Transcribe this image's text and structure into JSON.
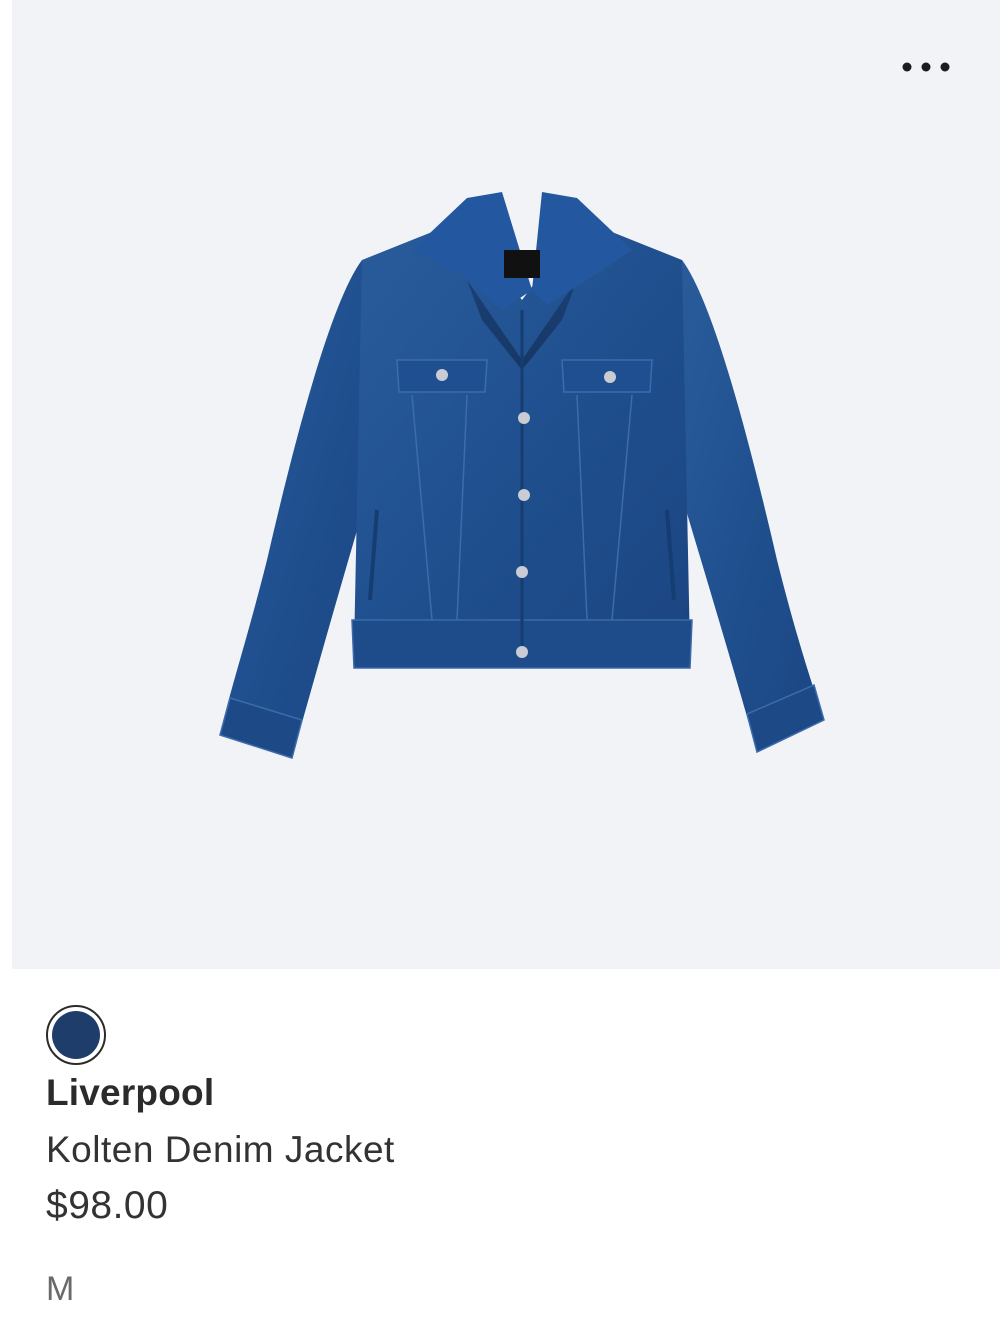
{
  "product": {
    "brand": "Liverpool",
    "name": "Kolten Denim Jacket",
    "price": "$98.00",
    "size": "M",
    "swatch_color": "#1e3d6b",
    "image_background": "#f1f3f6",
    "denim_color": "#1f4f8f",
    "image_icon": "denim-jacket-photo"
  },
  "actions": {
    "more_icon": "more-horizontal-icon"
  }
}
